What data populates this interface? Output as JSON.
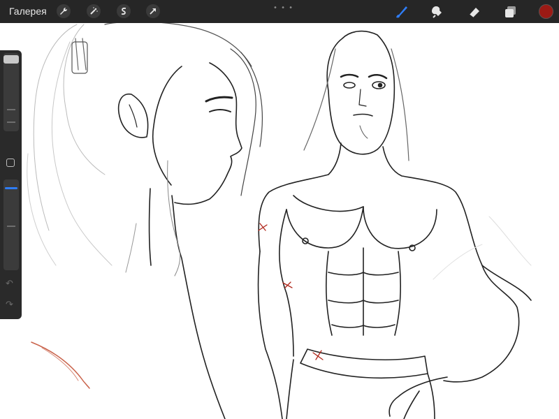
{
  "app": {
    "gallery_label": "Галерея"
  },
  "toolbar_left": [
    {
      "name": "actions-wrench-icon"
    },
    {
      "name": "adjustments-magic-wand-icon"
    },
    {
      "name": "selection-s-icon"
    },
    {
      "name": "transform-arrow-icon"
    }
  ],
  "toolbar_right": [
    {
      "name": "brush-tool-icon",
      "active": true
    },
    {
      "name": "smudge-tool-icon"
    },
    {
      "name": "eraser-tool-icon"
    },
    {
      "name": "layers-icon"
    }
  ],
  "colors": {
    "active_color": "#9c1a14",
    "accent_blue": "#2f7df6",
    "toolbar_bg": "#262626"
  },
  "sidebar": {
    "brush_size_slider": "brush-size",
    "opacity_slider": "brush-opacity",
    "undo_symbol": "↶",
    "redo_symbol": "↷"
  },
  "canvas": {
    "description_icon": "sketch-canvas"
  }
}
